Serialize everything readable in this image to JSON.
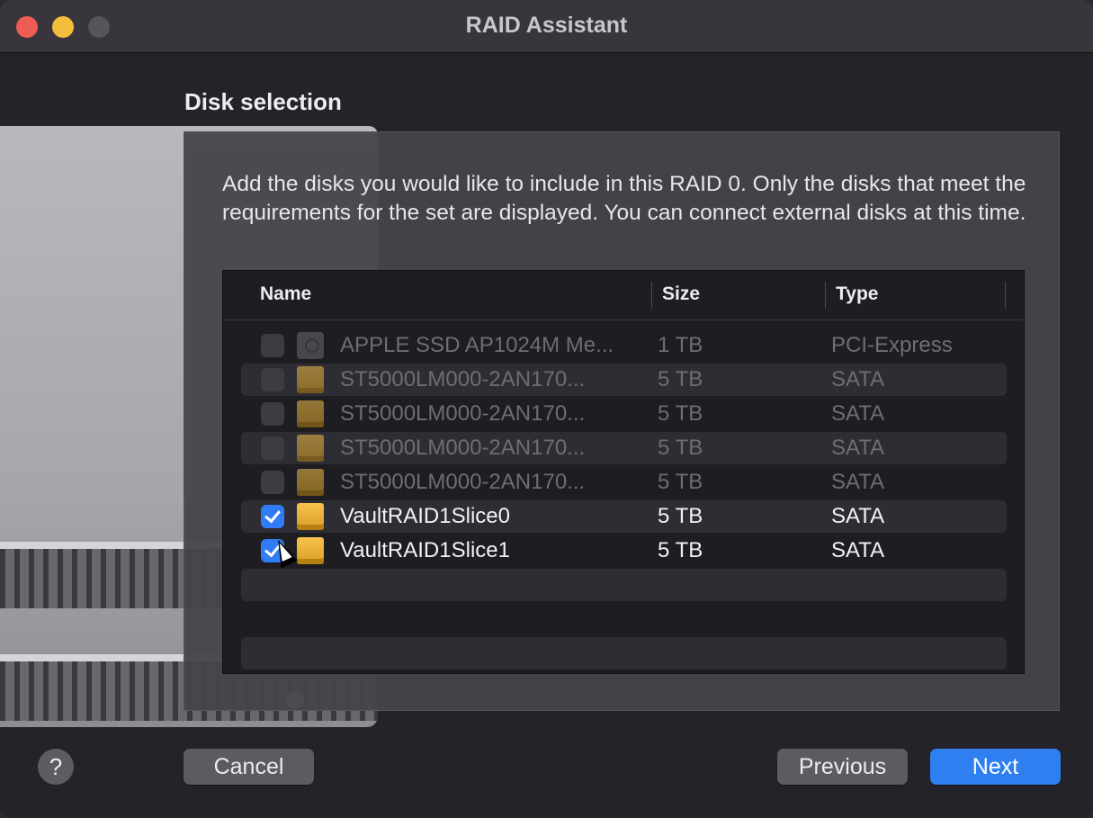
{
  "window": {
    "title": "RAID Assistant"
  },
  "section": {
    "title": "Disk selection"
  },
  "description": "Add the disks you would like to include in this RAID 0. Only the disks that meet the requirements for the set are displayed. You can connect external disks at this time.",
  "table": {
    "columns": {
      "name": "Name",
      "size": "Size",
      "type": "Type"
    },
    "rows": [
      {
        "name": "APPLE SSD AP1024M Me...",
        "size": "1 TB",
        "type": "PCI-Express",
        "checked": false,
        "enabled": false,
        "icon": "ssd-icon"
      },
      {
        "name": "ST5000LM000-2AN170...",
        "size": "5 TB",
        "type": "SATA",
        "checked": false,
        "enabled": false,
        "icon": "hdd-icon"
      },
      {
        "name": "ST5000LM000-2AN170...",
        "size": "5 TB",
        "type": "SATA",
        "checked": false,
        "enabled": false,
        "icon": "hdd-icon"
      },
      {
        "name": "ST5000LM000-2AN170...",
        "size": "5 TB",
        "type": "SATA",
        "checked": false,
        "enabled": false,
        "icon": "hdd-icon"
      },
      {
        "name": "ST5000LM000-2AN170...",
        "size": "5 TB",
        "type": "SATA",
        "checked": false,
        "enabled": false,
        "icon": "hdd-icon"
      },
      {
        "name": "VaultRAID1Slice0",
        "size": "5 TB",
        "type": "SATA",
        "checked": true,
        "enabled": true,
        "icon": "hdd-icon"
      },
      {
        "name": "VaultRAID1Slice1",
        "size": "5 TB",
        "type": "SATA",
        "checked": true,
        "enabled": true,
        "icon": "hdd-icon"
      }
    ]
  },
  "buttons": {
    "help": "?",
    "cancel": "Cancel",
    "previous": "Previous",
    "next": "Next"
  },
  "colors": {
    "accent": "#2f7ff0",
    "close": "#ee5c53",
    "minimize": "#f5bd3d"
  }
}
